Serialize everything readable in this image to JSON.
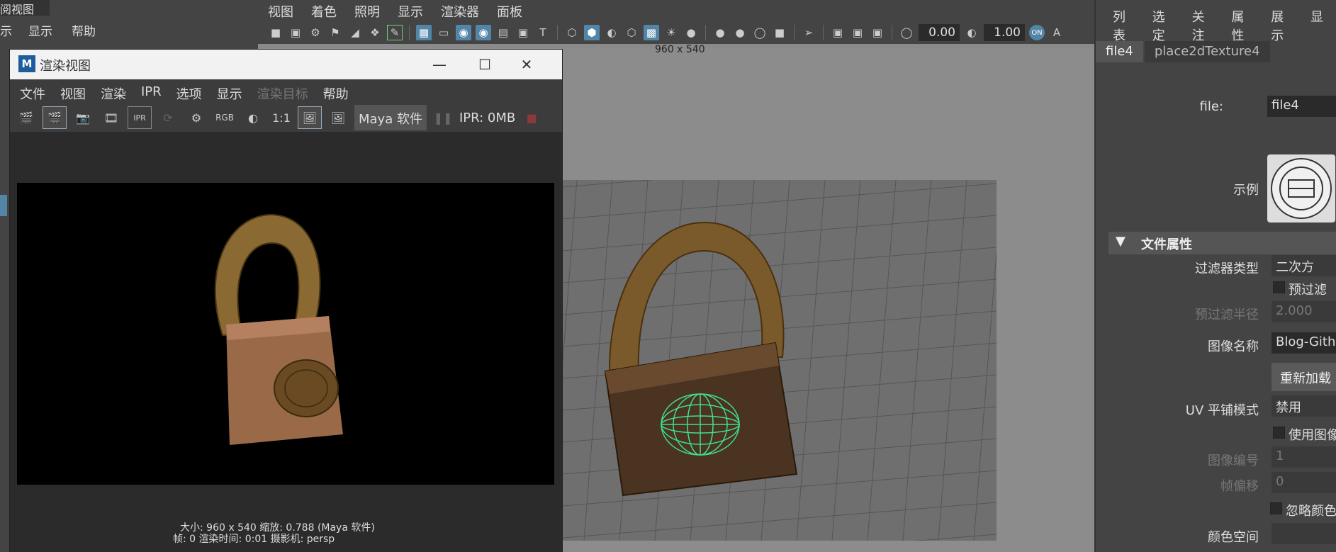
{
  "left": {
    "title_fragment": "阅视图",
    "menu": [
      "示",
      "显示",
      "帮助"
    ]
  },
  "viewport": {
    "menu": [
      "视图",
      "着色",
      "照明",
      "显示",
      "渲染器",
      "面板"
    ],
    "exposure_value": "0.00",
    "gamma_value": "1.00",
    "resolution_label": "960 x 540"
  },
  "render_window": {
    "title": "渲染视图",
    "logo": "M",
    "menu": [
      {
        "label": "文件",
        "enabled": true
      },
      {
        "label": "视图",
        "enabled": true
      },
      {
        "label": "渲染",
        "enabled": true
      },
      {
        "label": "IPR",
        "enabled": true
      },
      {
        "label": "选项",
        "enabled": true
      },
      {
        "label": "显示",
        "enabled": true
      },
      {
        "label": "渲染目标",
        "enabled": false
      },
      {
        "label": "帮助",
        "enabled": true
      }
    ],
    "toolbar": {
      "rgb_label": "RGB",
      "ratio_label": "1:1",
      "renderer_label": "Maya 软件",
      "ipr_status": "IPR: 0MB",
      "ipr_icon_label": "IPR"
    },
    "info_line1": "大小: 960 x 540  缩放: 0.788      (Maya 软件)",
    "info_line2": "帧: 0       渲染时间: 0:01        摄影机: persp"
  },
  "attribute_editor": {
    "menu": [
      "列表",
      "选定",
      "关注",
      "属性",
      "展示",
      "显"
    ],
    "tabs": [
      {
        "label": "file4",
        "active": true
      },
      {
        "label": "place2dTexture4",
        "active": false
      }
    ],
    "file_label": "file:",
    "file_value": "file4",
    "sample_label": "示例",
    "section_title": "文件属性",
    "filter_type_label": "过滤器类型",
    "filter_type_value": "二次方",
    "prefilter_label": "预过滤",
    "prefilter_radius_label": "预过滤半径",
    "prefilter_radius_value": "2.000",
    "image_name_label": "图像名称",
    "image_name_value": "Blog-Githu",
    "reload_label": "重新加载",
    "uv_tiling_label": "UV 平铺模式",
    "uv_tiling_value": "禁用",
    "use_image_seq_label": "使用图像",
    "image_number_label": "图像编号",
    "image_number_value": "1",
    "frame_offset_label": "帧偏移",
    "frame_offset_value": "0",
    "ignore_color_label": "忽略颜色",
    "color_space_label": "颜色空间"
  },
  "colors": {
    "panel_bg": "#444444",
    "viewport_bg": "#8a8a8a",
    "active_blue": "#5285a6",
    "wireframe_green": "#3fe08a"
  }
}
